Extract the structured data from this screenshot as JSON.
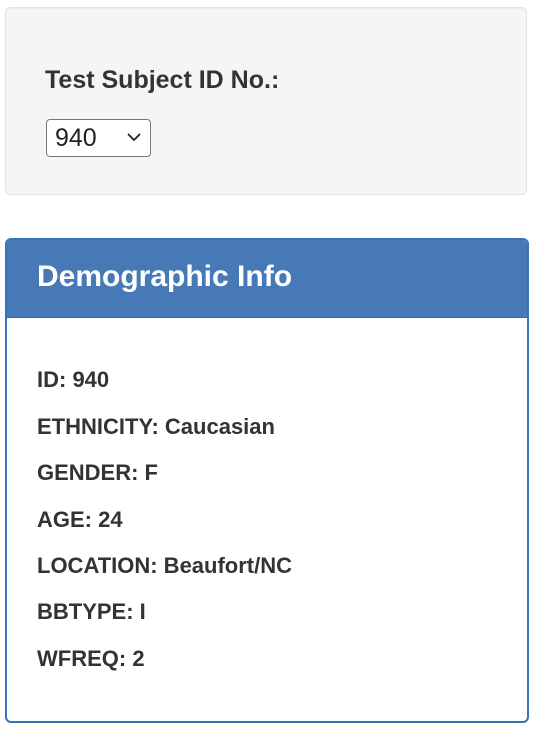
{
  "selector": {
    "label": "Test Subject ID No.:",
    "selected_value": "940",
    "chevron_icon": "chevron-down-icon"
  },
  "panel": {
    "title": "Demographic Info",
    "header_color": "#4779b6",
    "border_color": "#3a72b8",
    "lines": [
      "ID: 940",
      "ETHNICITY: Caucasian",
      "GENDER: F",
      "AGE: 24",
      "LOCATION: Beaufort/NC",
      "BBTYPE: I",
      "WFREQ: 2"
    ]
  }
}
